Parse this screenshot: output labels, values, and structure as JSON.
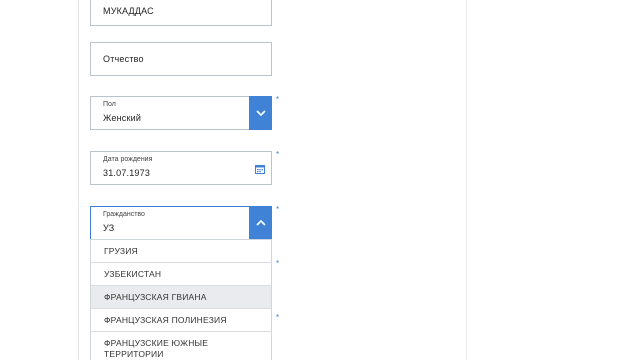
{
  "form": {
    "first_name": {
      "value": "МУКАДДАС"
    },
    "patronymic": {
      "placeholder": "Отчество"
    },
    "gender": {
      "label": "Пол",
      "value": "Женский"
    },
    "birth_date": {
      "label": "Дата рождения",
      "value": "31.07.1973"
    },
    "citizenship": {
      "label": "Гражданство",
      "value": "УЗ",
      "options": [
        "ГРУЗИЯ",
        "УЗБЕКИСТАН",
        "ФРАНЦУЗСКАЯ ГВИАНА",
        "ФРАНЦУЗСКАЯ ПОЛИНЕЗИЯ",
        "ФРАНЦУЗСКИЕ ЮЖНЫЕ\nТЕРРИТОРИИ"
      ],
      "highlighted_option": "ФРАНЦУЗСКАЯ ГВИАНА"
    },
    "required_marker": "*"
  },
  "colors": {
    "accent": "#3f82d6",
    "field_border": "#b9c3cc",
    "highlight_bg": "#e9ebee"
  },
  "icons": {
    "select_arrow": "chevron-down-icon",
    "open_arrow": "chevron-up-icon",
    "calendar": "calendar-icon"
  }
}
